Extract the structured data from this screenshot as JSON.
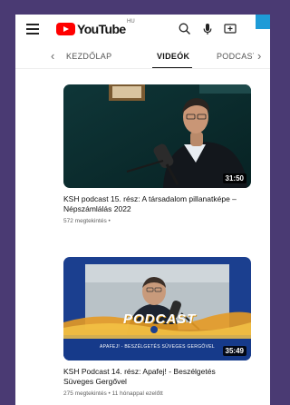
{
  "colors": {
    "background": "#4a3a73",
    "accent": "#1e9bd7",
    "youtube_red": "#ff0000"
  },
  "header": {
    "logo_text": "YouTube",
    "region": "HU",
    "icons": [
      "menu-icon",
      "search-icon",
      "mic-icon",
      "cast-icon"
    ]
  },
  "tabs": {
    "items": [
      {
        "label": "KEZDŐLAP"
      },
      {
        "label": "VIDEÓK",
        "active": true
      },
      {
        "label": "PODCAST"
      }
    ]
  },
  "videos": [
    {
      "title": "KSH podcast 15. rész: A társadalom pillanatképe – Népszámlálás 2022",
      "meta": "572 megtekintés •",
      "duration": "31:50"
    },
    {
      "title": "KSH Podcast 14. rész: Apafej! - Beszélgetés Süveges Gergővel",
      "meta": "275 megtekintés • 11 hónappal ezelőtt",
      "duration": "35:49",
      "banner": "APAFEJ! - BESZÉLGETÉS SÜVEGES GERGŐVEL",
      "podcast_word": "PODCAST"
    }
  ]
}
